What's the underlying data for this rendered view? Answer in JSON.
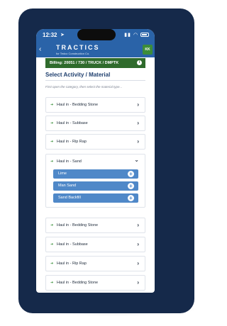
{
  "status": {
    "time": "12:32"
  },
  "header": {
    "brand": "TRACTICS",
    "brand_sub": "for Tedco Construction Co.",
    "avatar": "KK"
  },
  "billing": {
    "label": "Billing:  20051 / 730 / TRUCK / DMPTK"
  },
  "page": {
    "title": "Select Activity / Material",
    "instruction": "First open the category, then select the material type..."
  },
  "activities": [
    {
      "label": "Haul in - Bedding Stone",
      "expanded": false
    },
    {
      "label": "Haul in - Subbase",
      "expanded": false
    },
    {
      "label": "Haul in - Rip Rap",
      "expanded": false
    },
    {
      "label": "Haul in - Sand",
      "expanded": true,
      "materials": [
        "Lime",
        "Man Sand",
        "Sand Backfill"
      ]
    },
    {
      "label": "Haul in - Bedding Stone",
      "expanded": false
    },
    {
      "label": "Haul in - Subbase",
      "expanded": false
    },
    {
      "label": "Haul in - Rip Rap",
      "expanded": false
    },
    {
      "label": "Haul in - Bedding Stone",
      "expanded": false
    }
  ],
  "icons": {
    "activity": "haul-in-icon",
    "collapsed": "chevron-right-icon",
    "expanded": "chevron-down-icon",
    "add": "add-circle-icon"
  },
  "colors": {
    "frame": "#15294a",
    "header": "#2a63a8",
    "billing": "#2f6b2c",
    "material_button": "#4f88c8"
  }
}
